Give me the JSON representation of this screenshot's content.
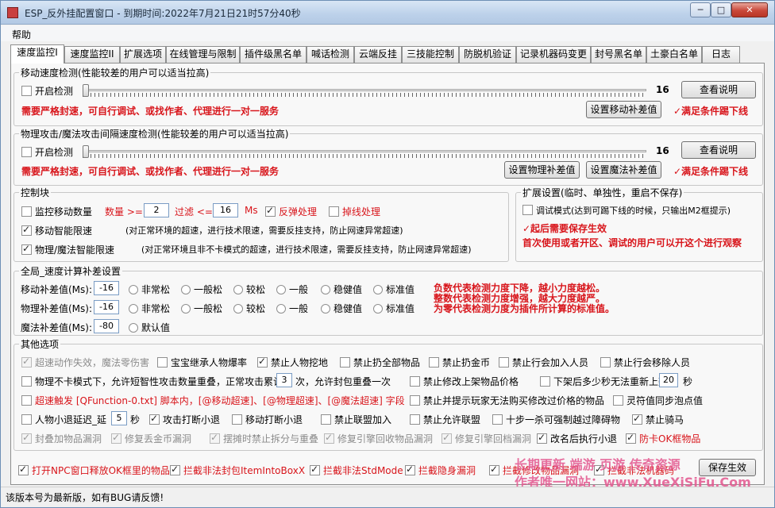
{
  "window": {
    "title": "ESP_反外挂配置窗口 - 到期时间:2022年7月21日21时57分40秒",
    "min_glyph": "─",
    "max_glyph": "□",
    "close_glyph": "✕"
  },
  "menu": {
    "help": "帮助"
  },
  "tabs": [
    "速度监控I",
    "速度监控II",
    "扩展选项",
    "在线管理与限制",
    "插件级黑名单",
    "喊话检测",
    "云端反挂",
    "三技能控制",
    "防脱机验证",
    "记录机器码变更",
    "封号黑名单",
    "土豪白名单",
    "日志"
  ],
  "active_tab": 0,
  "move_speed": {
    "title": "移动速度检测(性能较差的用户可以适当拉高)",
    "enable_label": "开启检测",
    "enabled": false,
    "slider_value": "16",
    "help_button": "查看说明",
    "notice": "需要严格封速，可自行调试、或找作者、代理进行一对一服务",
    "compensate_button": "设置移动补差值",
    "kick_text": "✓满足条件踢下线"
  },
  "attack_speed": {
    "title": "物理攻击/魔法攻击间隔速度检测(性能较差的用户可以适当拉高)",
    "enable_label": "开启检测",
    "enabled": false,
    "slider_value": "16",
    "help_button": "查看说明",
    "notice": "需要严格封速，可自行调试、或找作者、代理进行一对一服务",
    "physical_button": "设置物理补差值",
    "magic_button": "设置魔法补差值",
    "kick_text": "✓满足条件踢下线"
  },
  "control": {
    "title": "控制块",
    "monitor_label": "监控移动数量",
    "monitor_checked": false,
    "count_label": "数量 >=",
    "count_value": "2",
    "filter_label": "过滤 <=",
    "filter_value": "16",
    "ms_label": "Ms",
    "bounce_label": "反弹处理",
    "bounce_checked": true,
    "disconnect_label": "掉线处理",
    "disconnect_checked": false,
    "smart_move_label": "移动智能限速",
    "smart_move_checked": true,
    "smart_move_desc": "(对正常环境的超速，进行技术限速，需要反挂支持，防止网速异常超速)",
    "smart_attack_label": "物理/魔法智能限速",
    "smart_attack_checked": true,
    "smart_attack_desc": "(对正常环境且非不卡模式的超速，进行技术限速，需要反挂支持，防止网速异常超速)"
  },
  "extend": {
    "title": "扩展设置(临时、单独性，重启不保存)",
    "debug_label": "调试模式(达到可踢下线的时候，只输出M2框提示)",
    "debug_checked": false,
    "save_note": "✓起后需要保存生效",
    "first_use_note": "首次使用或者开区、调试的用户可以开这个进行观察"
  },
  "global": {
    "title": "全局_速度计算补差设置",
    "rows": [
      {
        "label": "移动补差值(Ms):",
        "value": "-16",
        "options": [
          "非常松",
          "一般松",
          "较松",
          "一般",
          "稳健值",
          "标准值"
        ]
      },
      {
        "label": "物理补差值(Ms):",
        "value": "-16",
        "options": [
          "非常松",
          "一般松",
          "较松",
          "一般",
          "稳健值",
          "标准值"
        ]
      },
      {
        "label": "魔法补差值(Ms):",
        "value": "-80",
        "options": [
          "默认值"
        ]
      }
    ],
    "notes": [
      "负数代表检测力度下降，越小力度越松。",
      "整数代表检测力度增强，越大力度越严。",
      "为零代表检测力度为插件所计算的标准值。"
    ]
  },
  "other": {
    "title": "其他选项",
    "row1": [
      {
        "label": "超速动作失效，魔法零伤害",
        "checked": true,
        "disabled": true
      },
      {
        "label": "宝宝继承人物爆率",
        "checked": false
      },
      {
        "label": "禁止人物挖地",
        "checked": true
      },
      {
        "label": "禁止扔全部物品",
        "checked": false
      },
      {
        "label": "禁止扔金币",
        "checked": false
      },
      {
        "label": "禁止行会加入人员",
        "checked": false
      },
      {
        "label": "禁止行会移除人员",
        "checked": false
      }
    ],
    "row2": {
      "label": "物理不卡模式下，允许短智性攻击数量重叠，正常攻击累计",
      "value": "3",
      "suffix": "次，允许封包重叠一次",
      "checked": false,
      "item2": "禁止修改上架物品价格",
      "item3_label": "下架后多少秒无法重新上架",
      "item3_value": "20",
      "item3_suffix": "秒"
    },
    "row3": {
      "label": "超速触发 [QFunction-0.txt] 脚本内，[@移动超速]、[@物理超速]、[@魔法超速] 字段",
      "item2": "禁止并提示玩家无法购买修改过价格的物品",
      "item3": "灵符值同步泡点值"
    },
    "row4": {
      "label": "人物小退延迟_延",
      "value": "5",
      "suffix": "秒",
      "items": [
        {
          "label": "攻击打断小退",
          "checked": true
        },
        {
          "label": "移动打断小退",
          "checked": false
        },
        {
          "label": "禁止联盟加入",
          "checked": false
        },
        {
          "label": "禁止允许联盟",
          "checked": false
        },
        {
          "label": "十步一杀可强制越过障碍物",
          "checked": false
        },
        {
          "label": "禁止骑马",
          "checked": true
        }
      ]
    },
    "row5": [
      {
        "label": "封叠加物品漏洞",
        "checked": true
      },
      {
        "label": "修复丢金币漏洞",
        "checked": true
      },
      {
        "label": "摆摊时禁止拆分与重叠",
        "checked": true
      },
      {
        "label": "修复引擎回收物品漏洞",
        "checked": true
      },
      {
        "label": "修复引擎回档漏洞",
        "checked": true
      },
      {
        "label": "改名后执行小退",
        "checked": true
      },
      {
        "label": "防卡OK框物品",
        "checked": true
      }
    ]
  },
  "bottom": {
    "items": [
      "打开NPC窗口释放OK框里的物品",
      "拦截非法封包ItemIntoBoxX",
      "拦截非法StdMode",
      "拦截隐身漏洞",
      "拦截修改物品漏洞",
      "拦截非法机器码"
    ],
    "save_button": "保存生效"
  },
  "watermark": {
    "line1": "长期更新  端游  页游  传奇资源",
    "line2": "作者唯一网站：www.XueXiSiFu.Com"
  },
  "status": "该版本号为最新版，如有BUG请反馈!"
}
